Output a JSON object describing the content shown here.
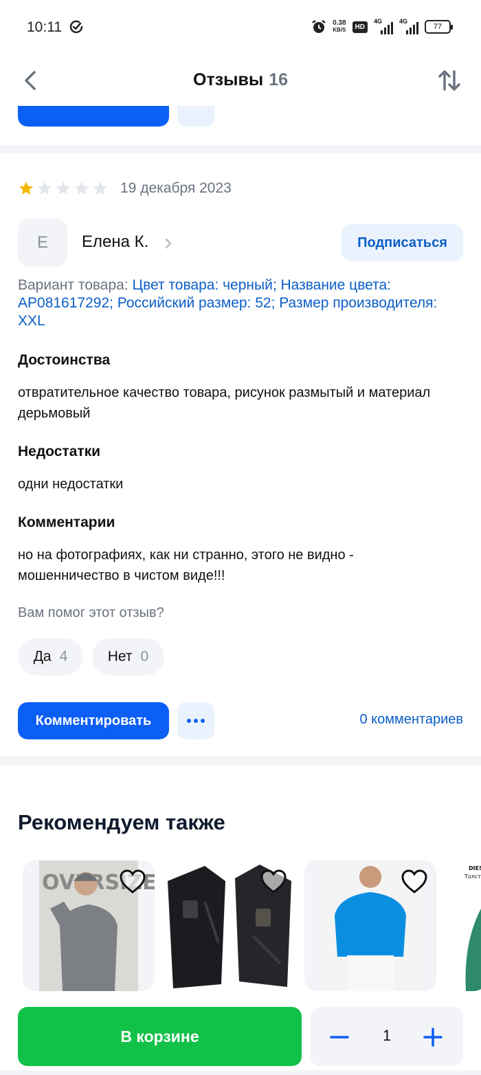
{
  "status_bar": {
    "time": "10:11",
    "net_speed_value": "0.38",
    "net_speed_unit": "KB/S",
    "hd_badge": "HD",
    "sim1_label": "4G",
    "sim2_label": "4G",
    "battery": "77"
  },
  "header": {
    "title": "Отзывы",
    "count": "16"
  },
  "review": {
    "rating": 1,
    "rating_max": 5,
    "date": "19 декабря 2023",
    "author_initial": "Е",
    "author_name": "Елена К.",
    "subscribe_label": "Подписаться",
    "variant_label": "Вариант товара:",
    "variant_value": "Цвет товара: черный; Название цвета: AP081617292; Российский размер: 52; Размер производителя: XXL",
    "pros_title": "Достоинства",
    "pros_text": "отвратительное качество товара, рисунок размытый и материал дерьмовый",
    "cons_title": "Недостатки",
    "cons_text": "одни недостатки",
    "comment_title": "Комментарии",
    "comment_text": "но на фотографиях, как ни странно, этого не видно - мошенничество в чистом виде!!!",
    "helpful_question": "Вам помог этот отзыв?",
    "yes_label": "Да",
    "yes_count": "4",
    "no_label": "Нет",
    "no_count": "0",
    "comment_button": "Комментировать",
    "comments_link": "0 комментариев"
  },
  "recommendations": {
    "title": "Рекомендуем также",
    "items": [
      {
        "image": "grey-oversize-hoodie-model",
        "photo_text": "OVERSIZE"
      },
      {
        "image": "black-tactical-jacket"
      },
      {
        "image": "blue-hoodie-model"
      },
      {
        "image": "green-hoodie-diesel",
        "photo_text": "DIESEL",
        "photo_subtext": "Толстов"
      }
    ]
  },
  "cart": {
    "button_label": "В корзине",
    "quantity": "1"
  },
  "colors": {
    "primary_blue": "#0b5ff5",
    "link_blue": "#0b5ec7",
    "green": "#12c148",
    "star_active": "#f6b600",
    "star_inactive": "#e3e6ea"
  }
}
